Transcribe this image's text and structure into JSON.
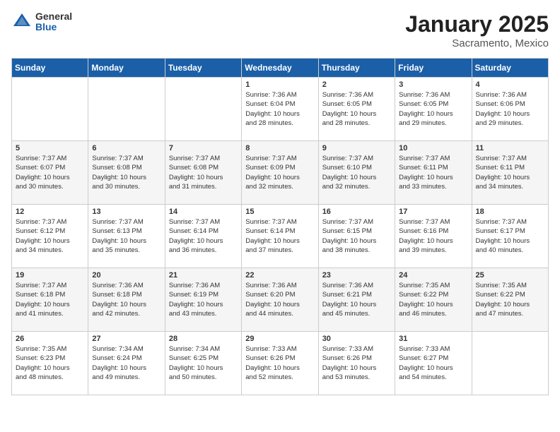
{
  "logo": {
    "general": "General",
    "blue": "Blue"
  },
  "header": {
    "title": "January 2025",
    "subtitle": "Sacramento, Mexico"
  },
  "weekdays": [
    "Sunday",
    "Monday",
    "Tuesday",
    "Wednesday",
    "Thursday",
    "Friday",
    "Saturday"
  ],
  "weeks": [
    [
      {
        "day": null,
        "info": null
      },
      {
        "day": null,
        "info": null
      },
      {
        "day": null,
        "info": null
      },
      {
        "day": "1",
        "info": "Sunrise: 7:36 AM\nSunset: 6:04 PM\nDaylight: 10 hours\nand 28 minutes."
      },
      {
        "day": "2",
        "info": "Sunrise: 7:36 AM\nSunset: 6:05 PM\nDaylight: 10 hours\nand 28 minutes."
      },
      {
        "day": "3",
        "info": "Sunrise: 7:36 AM\nSunset: 6:05 PM\nDaylight: 10 hours\nand 29 minutes."
      },
      {
        "day": "4",
        "info": "Sunrise: 7:36 AM\nSunset: 6:06 PM\nDaylight: 10 hours\nand 29 minutes."
      }
    ],
    [
      {
        "day": "5",
        "info": "Sunrise: 7:37 AM\nSunset: 6:07 PM\nDaylight: 10 hours\nand 30 minutes."
      },
      {
        "day": "6",
        "info": "Sunrise: 7:37 AM\nSunset: 6:08 PM\nDaylight: 10 hours\nand 30 minutes."
      },
      {
        "day": "7",
        "info": "Sunrise: 7:37 AM\nSunset: 6:08 PM\nDaylight: 10 hours\nand 31 minutes."
      },
      {
        "day": "8",
        "info": "Sunrise: 7:37 AM\nSunset: 6:09 PM\nDaylight: 10 hours\nand 32 minutes."
      },
      {
        "day": "9",
        "info": "Sunrise: 7:37 AM\nSunset: 6:10 PM\nDaylight: 10 hours\nand 32 minutes."
      },
      {
        "day": "10",
        "info": "Sunrise: 7:37 AM\nSunset: 6:11 PM\nDaylight: 10 hours\nand 33 minutes."
      },
      {
        "day": "11",
        "info": "Sunrise: 7:37 AM\nSunset: 6:11 PM\nDaylight: 10 hours\nand 34 minutes."
      }
    ],
    [
      {
        "day": "12",
        "info": "Sunrise: 7:37 AM\nSunset: 6:12 PM\nDaylight: 10 hours\nand 34 minutes."
      },
      {
        "day": "13",
        "info": "Sunrise: 7:37 AM\nSunset: 6:13 PM\nDaylight: 10 hours\nand 35 minutes."
      },
      {
        "day": "14",
        "info": "Sunrise: 7:37 AM\nSunset: 6:14 PM\nDaylight: 10 hours\nand 36 minutes."
      },
      {
        "day": "15",
        "info": "Sunrise: 7:37 AM\nSunset: 6:14 PM\nDaylight: 10 hours\nand 37 minutes."
      },
      {
        "day": "16",
        "info": "Sunrise: 7:37 AM\nSunset: 6:15 PM\nDaylight: 10 hours\nand 38 minutes."
      },
      {
        "day": "17",
        "info": "Sunrise: 7:37 AM\nSunset: 6:16 PM\nDaylight: 10 hours\nand 39 minutes."
      },
      {
        "day": "18",
        "info": "Sunrise: 7:37 AM\nSunset: 6:17 PM\nDaylight: 10 hours\nand 40 minutes."
      }
    ],
    [
      {
        "day": "19",
        "info": "Sunrise: 7:37 AM\nSunset: 6:18 PM\nDaylight: 10 hours\nand 41 minutes."
      },
      {
        "day": "20",
        "info": "Sunrise: 7:36 AM\nSunset: 6:18 PM\nDaylight: 10 hours\nand 42 minutes."
      },
      {
        "day": "21",
        "info": "Sunrise: 7:36 AM\nSunset: 6:19 PM\nDaylight: 10 hours\nand 43 minutes."
      },
      {
        "day": "22",
        "info": "Sunrise: 7:36 AM\nSunset: 6:20 PM\nDaylight: 10 hours\nand 44 minutes."
      },
      {
        "day": "23",
        "info": "Sunrise: 7:36 AM\nSunset: 6:21 PM\nDaylight: 10 hours\nand 45 minutes."
      },
      {
        "day": "24",
        "info": "Sunrise: 7:35 AM\nSunset: 6:22 PM\nDaylight: 10 hours\nand 46 minutes."
      },
      {
        "day": "25",
        "info": "Sunrise: 7:35 AM\nSunset: 6:22 PM\nDaylight: 10 hours\nand 47 minutes."
      }
    ],
    [
      {
        "day": "26",
        "info": "Sunrise: 7:35 AM\nSunset: 6:23 PM\nDaylight: 10 hours\nand 48 minutes."
      },
      {
        "day": "27",
        "info": "Sunrise: 7:34 AM\nSunset: 6:24 PM\nDaylight: 10 hours\nand 49 minutes."
      },
      {
        "day": "28",
        "info": "Sunrise: 7:34 AM\nSunset: 6:25 PM\nDaylight: 10 hours\nand 50 minutes."
      },
      {
        "day": "29",
        "info": "Sunrise: 7:33 AM\nSunset: 6:26 PM\nDaylight: 10 hours\nand 52 minutes."
      },
      {
        "day": "30",
        "info": "Sunrise: 7:33 AM\nSunset: 6:26 PM\nDaylight: 10 hours\nand 53 minutes."
      },
      {
        "day": "31",
        "info": "Sunrise: 7:33 AM\nSunset: 6:27 PM\nDaylight: 10 hours\nand 54 minutes."
      },
      {
        "day": null,
        "info": null
      }
    ]
  ]
}
